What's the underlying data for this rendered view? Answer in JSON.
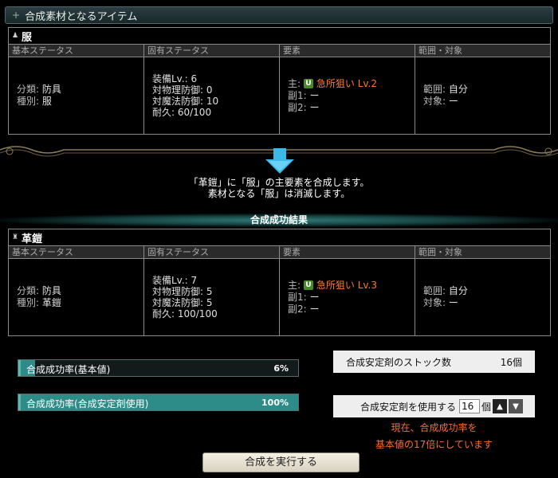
{
  "header": {
    "title": "合成素材となるアイテム",
    "plus": "+"
  },
  "column_headers": [
    "基本ステータス",
    "固有ステータス",
    "要素",
    "範囲・対象"
  ],
  "source_item": {
    "name": "服",
    "basic": {
      "type_label": "分類:",
      "type": "防具",
      "kind_label": "種別:",
      "kind": "服"
    },
    "unique": {
      "equip_lv": "装備Lv.: 6",
      "phys_def": "対物理防御: 0",
      "magic_def": "対魔法防御: 10",
      "durability": "耐久: 60/100"
    },
    "element": {
      "main_label": "主:",
      "main_icon": "U",
      "main": "急所狙い Lv.2",
      "sub1_label": "副1:",
      "sub1": "ー",
      "sub2_label": "副2:",
      "sub2": "ー"
    },
    "range": {
      "range_label": "範囲:",
      "range": "自分",
      "target_label": "対象:",
      "target": "ー"
    }
  },
  "message": {
    "line1": "「革鎧」に「服」の主要素を合成します。",
    "line2": "素材となる「服」は消滅します。"
  },
  "result_title": "合成成功結果",
  "result_item": {
    "name": "革鎧",
    "basic": {
      "type_label": "分類:",
      "type": "防具",
      "kind_label": "種別:",
      "kind": "革鎧"
    },
    "unique": {
      "equip_lv": "装備Lv.: 7",
      "phys_def": "対物理防御: 5",
      "magic_def": "対魔法防御: 5",
      "durability": "耐久: 100/100"
    },
    "element": {
      "main_label": "主:",
      "main_icon": "U",
      "main": "急所狙い Lv.3",
      "sub1_label": "副1:",
      "sub1": "ー",
      "sub2_label": "副2:",
      "sub2": "ー"
    },
    "range": {
      "range_label": "範囲:",
      "range": "自分",
      "target_label": "対象:",
      "target": "ー"
    }
  },
  "rates": {
    "base": {
      "label": "合成成功率(基本値)",
      "value": "6%",
      "fraction": 0.06
    },
    "with_stabilizer": {
      "label": "合成成功率(合成安定剤使用)",
      "value": "100%",
      "fraction": 1.0
    }
  },
  "stock": {
    "label": "合成安定剤のストック数",
    "value": "16個"
  },
  "use": {
    "label": "合成安定剤を使用する",
    "value": "16",
    "unit": "個"
  },
  "note": {
    "line1": "現在、合成成功率を",
    "line2": "基本値の17倍にしています"
  },
  "execute_button": "合成を実行する",
  "colors": {
    "accent_teal": "#2e8c88",
    "warning": "#ff6a2a",
    "element_main": "#ff7a2a"
  }
}
